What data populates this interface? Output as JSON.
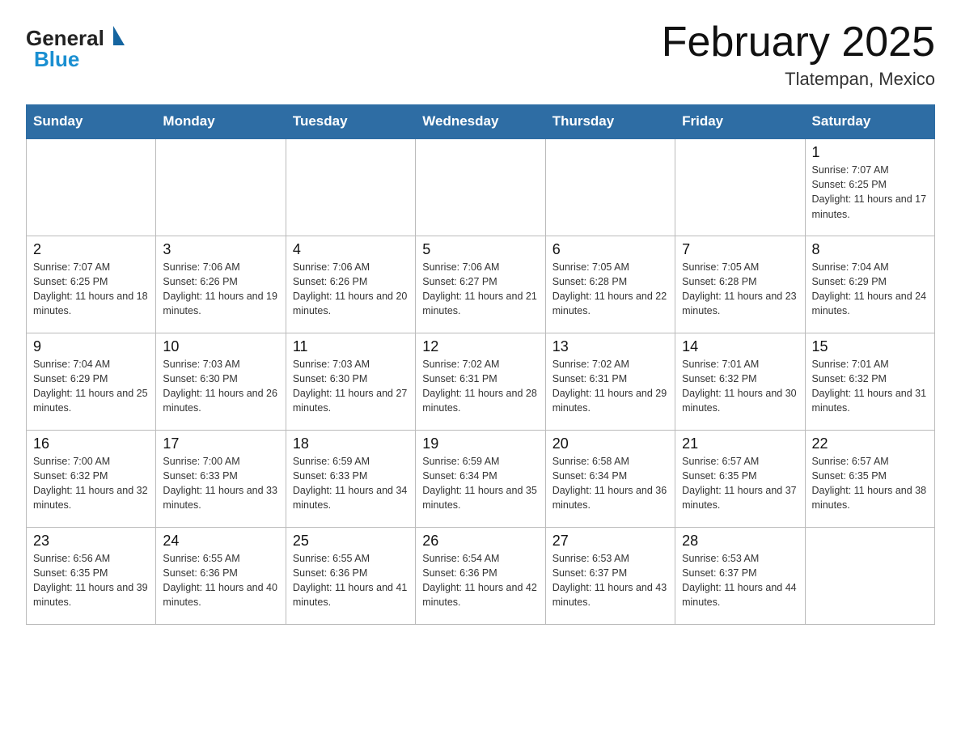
{
  "header": {
    "logo_general": "General",
    "logo_blue": "Blue",
    "month_title": "February 2025",
    "location": "Tlatempan, Mexico"
  },
  "days_of_week": [
    "Sunday",
    "Monday",
    "Tuesday",
    "Wednesday",
    "Thursday",
    "Friday",
    "Saturday"
  ],
  "weeks": [
    [
      {
        "day": "",
        "empty": true
      },
      {
        "day": "",
        "empty": true
      },
      {
        "day": "",
        "empty": true
      },
      {
        "day": "",
        "empty": true
      },
      {
        "day": "",
        "empty": true
      },
      {
        "day": "",
        "empty": true
      },
      {
        "day": "1",
        "sunrise": "7:07 AM",
        "sunset": "6:25 PM",
        "daylight": "11 hours and 17 minutes."
      }
    ],
    [
      {
        "day": "2",
        "sunrise": "7:07 AM",
        "sunset": "6:25 PM",
        "daylight": "11 hours and 18 minutes."
      },
      {
        "day": "3",
        "sunrise": "7:06 AM",
        "sunset": "6:26 PM",
        "daylight": "11 hours and 19 minutes."
      },
      {
        "day": "4",
        "sunrise": "7:06 AM",
        "sunset": "6:26 PM",
        "daylight": "11 hours and 20 minutes."
      },
      {
        "day": "5",
        "sunrise": "7:06 AM",
        "sunset": "6:27 PM",
        "daylight": "11 hours and 21 minutes."
      },
      {
        "day": "6",
        "sunrise": "7:05 AM",
        "sunset": "6:28 PM",
        "daylight": "11 hours and 22 minutes."
      },
      {
        "day": "7",
        "sunrise": "7:05 AM",
        "sunset": "6:28 PM",
        "daylight": "11 hours and 23 minutes."
      },
      {
        "day": "8",
        "sunrise": "7:04 AM",
        "sunset": "6:29 PM",
        "daylight": "11 hours and 24 minutes."
      }
    ],
    [
      {
        "day": "9",
        "sunrise": "7:04 AM",
        "sunset": "6:29 PM",
        "daylight": "11 hours and 25 minutes."
      },
      {
        "day": "10",
        "sunrise": "7:03 AM",
        "sunset": "6:30 PM",
        "daylight": "11 hours and 26 minutes."
      },
      {
        "day": "11",
        "sunrise": "7:03 AM",
        "sunset": "6:30 PM",
        "daylight": "11 hours and 27 minutes."
      },
      {
        "day": "12",
        "sunrise": "7:02 AM",
        "sunset": "6:31 PM",
        "daylight": "11 hours and 28 minutes."
      },
      {
        "day": "13",
        "sunrise": "7:02 AM",
        "sunset": "6:31 PM",
        "daylight": "11 hours and 29 minutes."
      },
      {
        "day": "14",
        "sunrise": "7:01 AM",
        "sunset": "6:32 PM",
        "daylight": "11 hours and 30 minutes."
      },
      {
        "day": "15",
        "sunrise": "7:01 AM",
        "sunset": "6:32 PM",
        "daylight": "11 hours and 31 minutes."
      }
    ],
    [
      {
        "day": "16",
        "sunrise": "7:00 AM",
        "sunset": "6:32 PM",
        "daylight": "11 hours and 32 minutes."
      },
      {
        "day": "17",
        "sunrise": "7:00 AM",
        "sunset": "6:33 PM",
        "daylight": "11 hours and 33 minutes."
      },
      {
        "day": "18",
        "sunrise": "6:59 AM",
        "sunset": "6:33 PM",
        "daylight": "11 hours and 34 minutes."
      },
      {
        "day": "19",
        "sunrise": "6:59 AM",
        "sunset": "6:34 PM",
        "daylight": "11 hours and 35 minutes."
      },
      {
        "day": "20",
        "sunrise": "6:58 AM",
        "sunset": "6:34 PM",
        "daylight": "11 hours and 36 minutes."
      },
      {
        "day": "21",
        "sunrise": "6:57 AM",
        "sunset": "6:35 PM",
        "daylight": "11 hours and 37 minutes."
      },
      {
        "day": "22",
        "sunrise": "6:57 AM",
        "sunset": "6:35 PM",
        "daylight": "11 hours and 38 minutes."
      }
    ],
    [
      {
        "day": "23",
        "sunrise": "6:56 AM",
        "sunset": "6:35 PM",
        "daylight": "11 hours and 39 minutes."
      },
      {
        "day": "24",
        "sunrise": "6:55 AM",
        "sunset": "6:36 PM",
        "daylight": "11 hours and 40 minutes."
      },
      {
        "day": "25",
        "sunrise": "6:55 AM",
        "sunset": "6:36 PM",
        "daylight": "11 hours and 41 minutes."
      },
      {
        "day": "26",
        "sunrise": "6:54 AM",
        "sunset": "6:36 PM",
        "daylight": "11 hours and 42 minutes."
      },
      {
        "day": "27",
        "sunrise": "6:53 AM",
        "sunset": "6:37 PM",
        "daylight": "11 hours and 43 minutes."
      },
      {
        "day": "28",
        "sunrise": "6:53 AM",
        "sunset": "6:37 PM",
        "daylight": "11 hours and 44 minutes."
      },
      {
        "day": "",
        "empty": true
      }
    ]
  ]
}
